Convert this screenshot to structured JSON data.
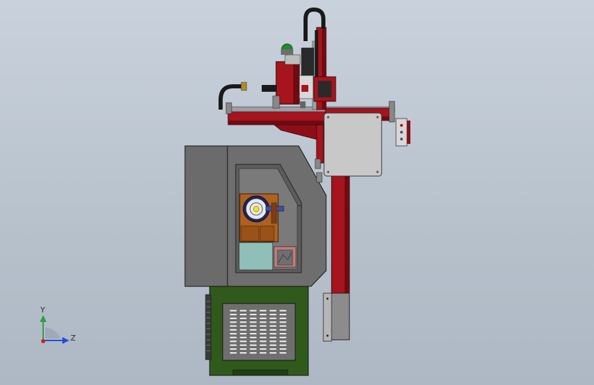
{
  "scene": {
    "view": "front",
    "background_top": "#c9d2dc",
    "background_bottom": "#aeb8c4"
  },
  "colors": {
    "cabinet_gray": "#6b6b6b",
    "cabinet_dark": "#4a4a4a",
    "base_green": "#2f5a1c",
    "base_green_dark": "#1f3f12",
    "gantry_red": "#a6141e",
    "gantry_red_dark": "#6e0c12",
    "panel_light": "#c8c8c8",
    "chuck_orange": "#b0601f",
    "window_teal": "#8fbfb8",
    "axis_y": "#2ea043",
    "axis_z": "#1f4fd8",
    "axis_x": "#d02020"
  },
  "triad": {
    "y_label": "Y",
    "z_label": "Z"
  }
}
